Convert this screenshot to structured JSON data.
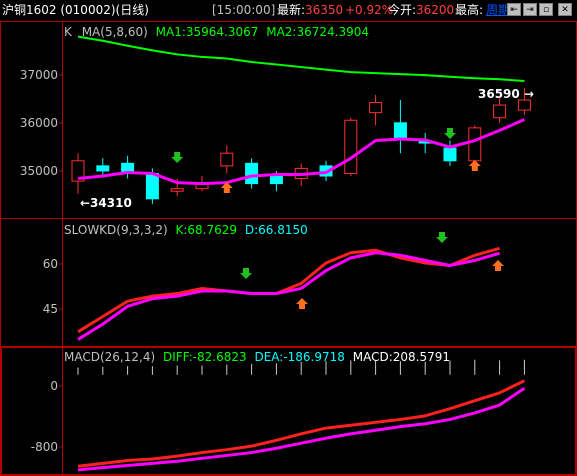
{
  "header": {
    "instrument": "沪铜1602 (010002)(日线)",
    "time": "[15:00:00]",
    "last_label": "最新:",
    "last_value": "36350",
    "change_pct": "+0.92%",
    "open_label": "今开:",
    "open_value": "36200",
    "high_label": "最高:",
    "period_link": "周期",
    "buttons": [
      "⇤",
      "⇥",
      "▫",
      "✕"
    ]
  },
  "colors": {
    "up": "#ff3030",
    "down": "#00ffff",
    "ma1": "#ff00ff",
    "ma2": "#00ff00",
    "kd_k": "#ff2020",
    "kd_d": "#ff00ff",
    "diff": "#ff2020",
    "dea": "#ff00ff",
    "axis": "#b00000"
  },
  "price_panel": {
    "indicator": "MA(5,8,60)",
    "ma1_text": "MA1:35964.3067",
    "ma2_text": "MA2:36724.3904",
    "k_label": "K",
    "low_annotation": "←34310",
    "high_annotation": "36590 →",
    "ticks": [
      "37000",
      "36000",
      "35000"
    ]
  },
  "kd_panel": {
    "indicator": "SLOWKD(9,3,3,2)",
    "k_text": "K:68.7629",
    "d_text": "D:66.8150",
    "ticks": [
      "60",
      "45"
    ]
  },
  "macd_panel": {
    "indicator": "MACD(26,12,4)",
    "diff_text": "DIFF:-82.6823",
    "dea_text": "DEA:-186.9718",
    "macd_text": "MACD:208.5791",
    "ticks": [
      "0",
      "-800"
    ]
  },
  "chart_data": [
    {
      "type": "candlestick",
      "candles": [
        {
          "o": 34750,
          "c": 35150,
          "h": 35300,
          "l": 34500
        },
        {
          "o": 35050,
          "c": 34950,
          "h": 35200,
          "l": 34850
        },
        {
          "o": 35100,
          "c": 34900,
          "h": 35250,
          "l": 34800
        },
        {
          "o": 34900,
          "c": 34400,
          "h": 35000,
          "l": 34300
        },
        {
          "o": 34550,
          "c": 34600,
          "h": 34800,
          "l": 34450
        },
        {
          "o": 34600,
          "c": 34700,
          "h": 34850,
          "l": 34550
        },
        {
          "o": 35050,
          "c": 35300,
          "h": 35450,
          "l": 34900
        },
        {
          "o": 35100,
          "c": 34700,
          "h": 35200,
          "l": 34600
        },
        {
          "o": 34850,
          "c": 34700,
          "h": 34950,
          "l": 34550
        },
        {
          "o": 34800,
          "c": 35000,
          "h": 35100,
          "l": 34650
        },
        {
          "o": 35050,
          "c": 34850,
          "h": 35150,
          "l": 34750
        },
        {
          "o": 34900,
          "c": 35950,
          "h": 36000,
          "l": 34850
        },
        {
          "o": 36100,
          "c": 36300,
          "h": 36450,
          "l": 35850
        },
        {
          "o": 35900,
          "c": 35600,
          "h": 36350,
          "l": 35300
        },
        {
          "o": 35550,
          "c": 35500,
          "h": 35700,
          "l": 35300
        },
        {
          "o": 35400,
          "c": 35150,
          "h": 35550,
          "l": 35050
        },
        {
          "o": 35150,
          "c": 35800,
          "h": 35850,
          "l": 35100
        },
        {
          "o": 36000,
          "c": 36250,
          "h": 36400,
          "l": 35900
        },
        {
          "o": 36150,
          "c": 36350,
          "h": 36590,
          "l": 36050
        }
      ],
      "ma1": [
        34800,
        34850,
        34920,
        34900,
        34720,
        34700,
        34720,
        34850,
        34880,
        34880,
        34920,
        35200,
        35550,
        35580,
        35560,
        35420,
        35550,
        35750,
        35964
      ],
      "ma2": [
        37600,
        37520,
        37420,
        37330,
        37250,
        37200,
        37170,
        37100,
        37050,
        37000,
        36950,
        36900,
        36880,
        36860,
        36840,
        36810,
        36780,
        36760,
        36724
      ],
      "ylim": [
        34100,
        37850
      ]
    },
    {
      "type": "line",
      "series": [
        {
          "name": "K",
          "values": [
            36,
            42,
            48,
            50,
            51,
            53,
            52,
            51,
            51,
            55,
            63,
            67,
            68,
            65,
            63,
            62,
            66,
            68.76
          ]
        },
        {
          "name": "D",
          "values": [
            33,
            39,
            46,
            49,
            50,
            52,
            52,
            51,
            51,
            53,
            60,
            65,
            67,
            66,
            64,
            62,
            64,
            66.82
          ]
        }
      ],
      "ylim": [
        32,
        72
      ]
    },
    {
      "type": "line",
      "series": [
        {
          "name": "DIFF",
          "values": [
            -1270,
            -1230,
            -1190,
            -1170,
            -1130,
            -1080,
            -1040,
            -990,
            -910,
            -820,
            -740,
            -700,
            -660,
            -620,
            -570,
            -470,
            -360,
            -250,
            -82.68
          ]
        },
        {
          "name": "DEA",
          "values": [
            -1320,
            -1290,
            -1260,
            -1230,
            -1200,
            -1160,
            -1120,
            -1080,
            -1020,
            -950,
            -880,
            -820,
            -770,
            -720,
            -680,
            -620,
            -530,
            -420,
            -186.97
          ]
        }
      ],
      "macd_bars": [
        100,
        110,
        120,
        120,
        130,
        130,
        140,
        150,
        160,
        180,
        190,
        200,
        200,
        190,
        180,
        200,
        210,
        200,
        208.58
      ],
      "ylim": [
        -1350,
        150
      ]
    }
  ]
}
